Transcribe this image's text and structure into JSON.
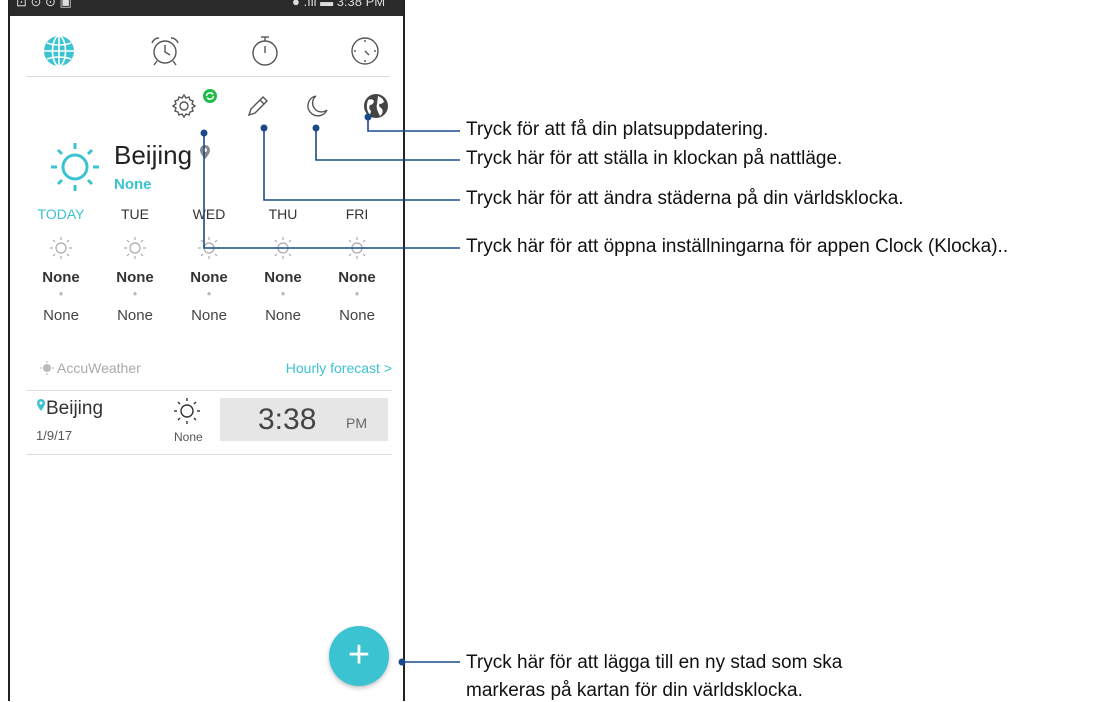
{
  "colors": {
    "accent": "#3cc3d1",
    "notify_green": "#22bb4a",
    "callout_line": "#1a4a8a"
  },
  "status_bar": {
    "left": "⊡ ⊙ ⊙ ▣",
    "right": "● .ıll ▬ 3:38 PM"
  },
  "tabs": [
    {
      "icon": "globe-icon",
      "active": true
    },
    {
      "icon": "alarm-clock-icon",
      "active": false
    },
    {
      "icon": "stopwatch-icon",
      "active": false
    },
    {
      "icon": "timer-icon",
      "active": false
    }
  ],
  "actions": {
    "settings_icon": "gear-icon",
    "edit_icon": "pencil-icon",
    "night_icon": "moon-icon",
    "location_icon": "earth-icon"
  },
  "weather": {
    "city": "Beijing",
    "condition": "None"
  },
  "forecast": [
    {
      "day": "TODAY",
      "high": "None",
      "low": "None",
      "today": true
    },
    {
      "day": "TUE",
      "high": "None",
      "low": "None",
      "today": false
    },
    {
      "day": "WED",
      "high": "None",
      "low": "None",
      "today": false
    },
    {
      "day": "THU",
      "high": "None",
      "low": "None",
      "today": false
    },
    {
      "day": "FRI",
      "high": "None",
      "low": "None",
      "today": false
    }
  ],
  "accuweather": {
    "brand": "AccuWeather",
    "hourly": "Hourly forecast >"
  },
  "world_clock": [
    {
      "city": "Beijing",
      "date": "1/9/17",
      "condition": "None",
      "time": "3:38",
      "ampm": "PM"
    }
  ],
  "fab": {
    "label": "+"
  },
  "callouts": [
    "Tryck för att få din platsuppdatering.",
    "Tryck här för att ställa in klockan på nattläge.",
    "Tryck här för att ändra städerna på din världsklocka.",
    "Tryck här för att öppna inställningarna för appen Clock (Klocka)..",
    "Tryck här för att lägga till en ny stad som ska",
    "markeras på kartan för din världsklocka."
  ]
}
